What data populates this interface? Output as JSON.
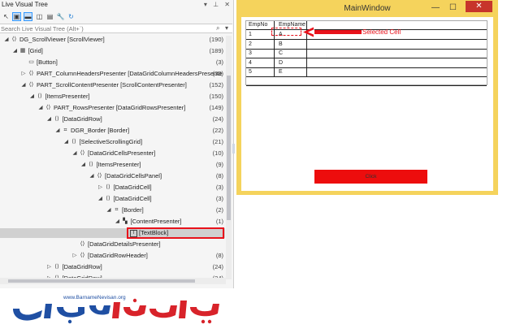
{
  "live_visual_tree": {
    "title": "Live Visual Tree",
    "title_controls": [
      "▾",
      "⊥",
      "✕"
    ],
    "toolbar": [
      "select-element-icon",
      "display-adorners-icon",
      "track-focus-icon",
      "preview-selection-icon",
      "show-just-my-xaml-icon",
      "settings-icon",
      "refresh-icon"
    ],
    "search": {
      "placeholder": "Search Live Visual Tree (Alt+`)",
      "value": ""
    },
    "rows": [
      {
        "level": 0,
        "exp": "◢",
        "icon": "code",
        "label": "DG_ScrollViewer [ScrollViewer]",
        "count": "(190)"
      },
      {
        "level": 1,
        "exp": "◢",
        "icon": "grid",
        "label": "[Grid]",
        "count": "(189)"
      },
      {
        "level": 2,
        "exp": "",
        "icon": "button",
        "label": "[Button]",
        "count": "(3)"
      },
      {
        "level": 2,
        "exp": "▷",
        "icon": "code",
        "label": "PART_ColumnHeadersPresenter [DataGridColumnHeadersPresente",
        "count": "(33)"
      },
      {
        "level": 2,
        "exp": "◢",
        "icon": "code",
        "label": "PART_ScrollContentPresenter [ScrollContentPresenter]",
        "count": "(152)"
      },
      {
        "level": 3,
        "exp": "◢",
        "icon": "code",
        "label": "[ItemsPresenter]",
        "count": "(150)"
      },
      {
        "level": 4,
        "exp": "◢",
        "icon": "code",
        "label": "PART_RowsPresenter [DataGridRowsPresenter]",
        "count": "(149)"
      },
      {
        "level": 5,
        "exp": "◢",
        "icon": "code",
        "label": "[DataGridRow]",
        "count": "(24)"
      },
      {
        "level": 6,
        "exp": "◢",
        "icon": "border",
        "label": "DGR_Border [Border]",
        "count": "(22)"
      },
      {
        "level": 7,
        "exp": "◢",
        "icon": "code",
        "label": "[SelectiveScrollingGrid]",
        "count": "(21)"
      },
      {
        "level": 8,
        "exp": "◢",
        "icon": "code",
        "label": "[DataGridCellsPresenter]",
        "count": "(10)"
      },
      {
        "level": 9,
        "exp": "◢",
        "icon": "code",
        "label": "[ItemsPresenter]",
        "count": "(9)"
      },
      {
        "level": 10,
        "exp": "◢",
        "icon": "code",
        "label": "[DataGridCellsPanel]",
        "count": "(8)"
      },
      {
        "level": 11,
        "exp": "▷",
        "icon": "code",
        "label": "[DataGridCell]",
        "count": "(3)"
      },
      {
        "level": 11,
        "exp": "◢",
        "icon": "code",
        "label": "[DataGridCell]",
        "count": "(3)"
      },
      {
        "level": 12,
        "exp": "◢",
        "icon": "border",
        "label": "[Border]",
        "count": "(2)"
      },
      {
        "level": 13,
        "exp": "◢",
        "icon": "content",
        "label": "[ContentPresenter]",
        "count": "(1)"
      },
      {
        "level": 14,
        "exp": "",
        "icon": "textblock",
        "label": "[TextBlock]",
        "count": "",
        "selected": true
      },
      {
        "level": 8,
        "exp": "",
        "icon": "code",
        "label": "[DataGridDetailsPresenter]",
        "count": ""
      },
      {
        "level": 8,
        "exp": "▷",
        "icon": "code",
        "label": "[DataGridRowHeader]",
        "count": "(8)"
      },
      {
        "level": 5,
        "exp": "▷",
        "icon": "code",
        "label": "[DataGridRow]",
        "count": "(24)"
      },
      {
        "level": 5,
        "exp": "▷",
        "icon": "code",
        "label": "[DataGridRow]",
        "count": "(24)"
      }
    ]
  },
  "main_window": {
    "title": "MainWindow",
    "controls": {
      "minimize": "—",
      "maximize": "☐",
      "close": "✕"
    },
    "grid": {
      "columns": [
        "EmpNo",
        "EmpName"
      ],
      "rows": [
        [
          "1",
          "A"
        ],
        [
          "2",
          "B"
        ],
        [
          "3",
          "C"
        ],
        [
          "4",
          "D"
        ],
        [
          "5",
          "E"
        ]
      ]
    },
    "annotation_label": "Selected Cell",
    "button_label": "Click"
  },
  "watermark": {
    "url": "www.BarnameNevisan.org",
    "logo_text": "برنامه نویسان"
  },
  "colors": {
    "highlight_red": "#e8121b",
    "window_frame": "#f5d35c",
    "close_button": "#c7352b",
    "button_red": "#ed0d0d",
    "logo_blue": "#1f4fa3",
    "logo_red": "#d8232a"
  }
}
